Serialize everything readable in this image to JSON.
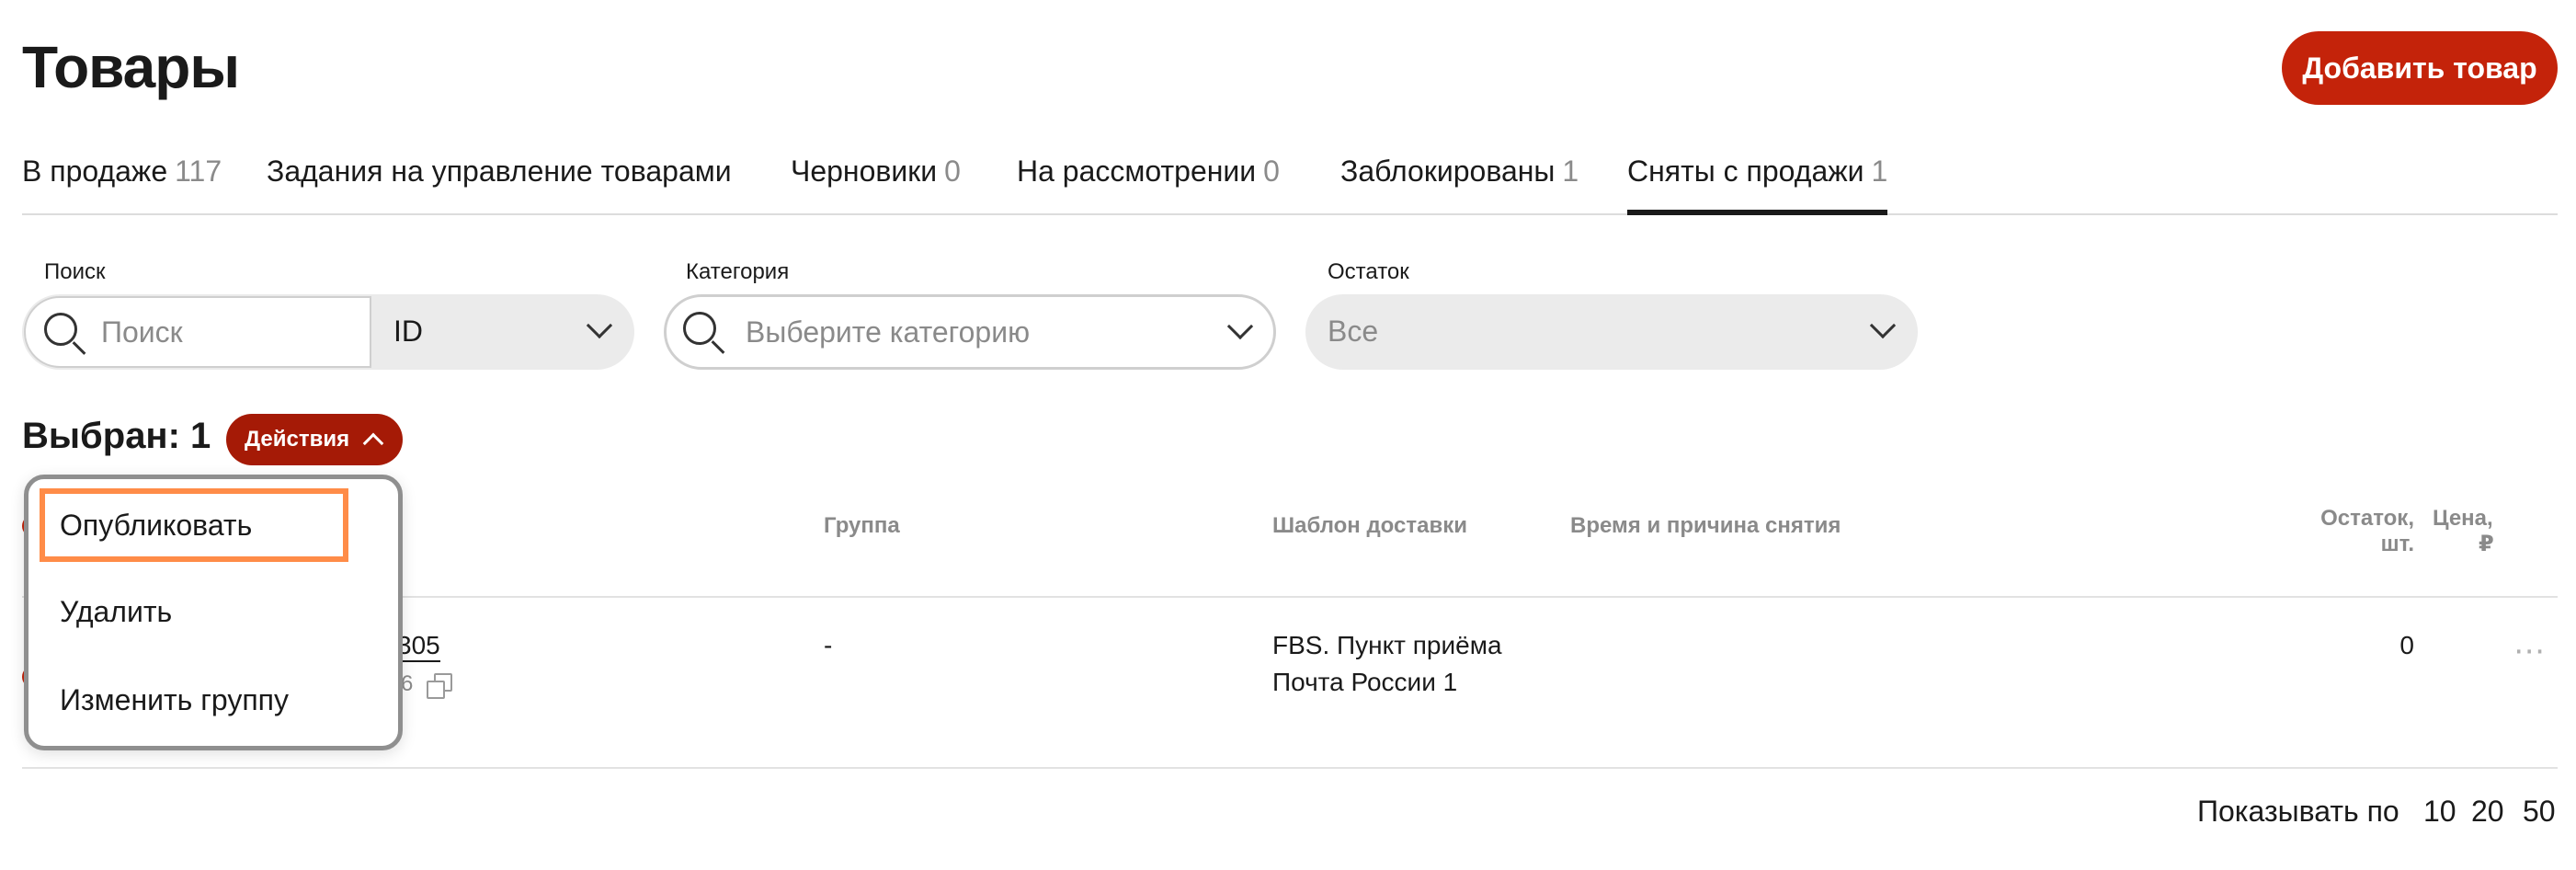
{
  "header": {
    "title": "Товары",
    "add_button": "Добавить товар"
  },
  "tabs": [
    {
      "label": "В продаже",
      "count": "117"
    },
    {
      "label": "Задания на управление товарами",
      "count": ""
    },
    {
      "label": "Черновики",
      "count": "0"
    },
    {
      "label": "На рассмотрении",
      "count": "0"
    },
    {
      "label": "Заблокированы",
      "count": "1"
    },
    {
      "label": "Сняты с продажи",
      "count": "1",
      "active": true
    }
  ],
  "filters": {
    "search_label": "Поиск",
    "search_placeholder": "Поиск",
    "search_type": "ID",
    "category_label": "Категория",
    "category_placeholder": "Выберите категорию",
    "stock_label": "Остаток",
    "stock_value": "Все"
  },
  "selection": {
    "selected_label": "Выбран: 1",
    "actions_button": "Действия"
  },
  "actions_menu": {
    "items": [
      "Опубликовать",
      "Удалить",
      "Изменить группу"
    ],
    "highlighted": "Опубликовать"
  },
  "table": {
    "columns": {
      "group": "Группа",
      "delivery": "Шаблон доставки",
      "removal": "Время и причина снятия",
      "stock_line1": "Остаток,",
      "stock_line2": "шт.",
      "price_line1": "Цена,",
      "price_line2": "₽"
    },
    "rows": [
      {
        "id_fragment": "305",
        "sub_fragment": "6",
        "group": "-",
        "delivery_line1": "FBS. Пункт приёма",
        "delivery_line2": "Почта России 1",
        "removal": "",
        "stock": "0",
        "more": "⋯"
      }
    ]
  },
  "pagination": {
    "label": "Показывать по",
    "options": [
      "10",
      "20",
      "50"
    ],
    "current": "10"
  },
  "colors": {
    "brand_red": "#c4230a",
    "actions_red": "#a51a06",
    "highlight_orange": "#ff8c48"
  }
}
